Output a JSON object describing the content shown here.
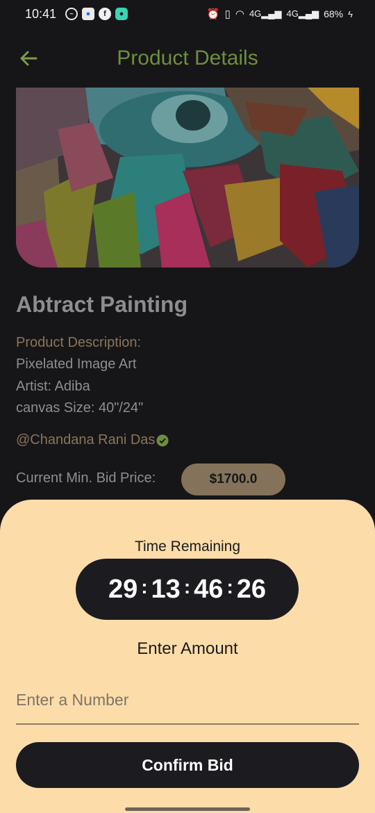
{
  "status_bar": {
    "time": "10:41",
    "notification_icons": [
      "messenger-icon",
      "signal-icon",
      "facebook-icon",
      "chat-icon"
    ],
    "system_icons": [
      "alarm-icon",
      "vibrate-icon",
      "wifi-icon",
      "signal-4g-icon",
      "signal-4g-icon"
    ],
    "network_1": "4G",
    "network_2": "4G",
    "battery": "68%"
  },
  "app_bar": {
    "title": "Product Details",
    "back_icon": "back-arrow-icon",
    "accent_color": "#6f8e3d"
  },
  "product": {
    "name": "Abtract Painting",
    "description_label": "Product Description:",
    "description_lines": [
      "Pixelated Image Art",
      "Artist: Adiba",
      "canvas Size: 40\"/24\""
    ],
    "artist_handle": "@Chandana Rani Das",
    "verified_icon": "verified-badge-icon",
    "bid_label": "Current Min. Bid Price:",
    "bid_price": "$1700.0"
  },
  "bid_sheet": {
    "time_label": "Time Remaining",
    "timer": {
      "days": "29",
      "hours": "13",
      "minutes": "46",
      "seconds": "26"
    },
    "amount_label": "Enter Amount",
    "amount_placeholder": "Enter a Number",
    "amount_value": "",
    "confirm_label": "Confirm Bid",
    "background_color": "#fcdca9"
  }
}
